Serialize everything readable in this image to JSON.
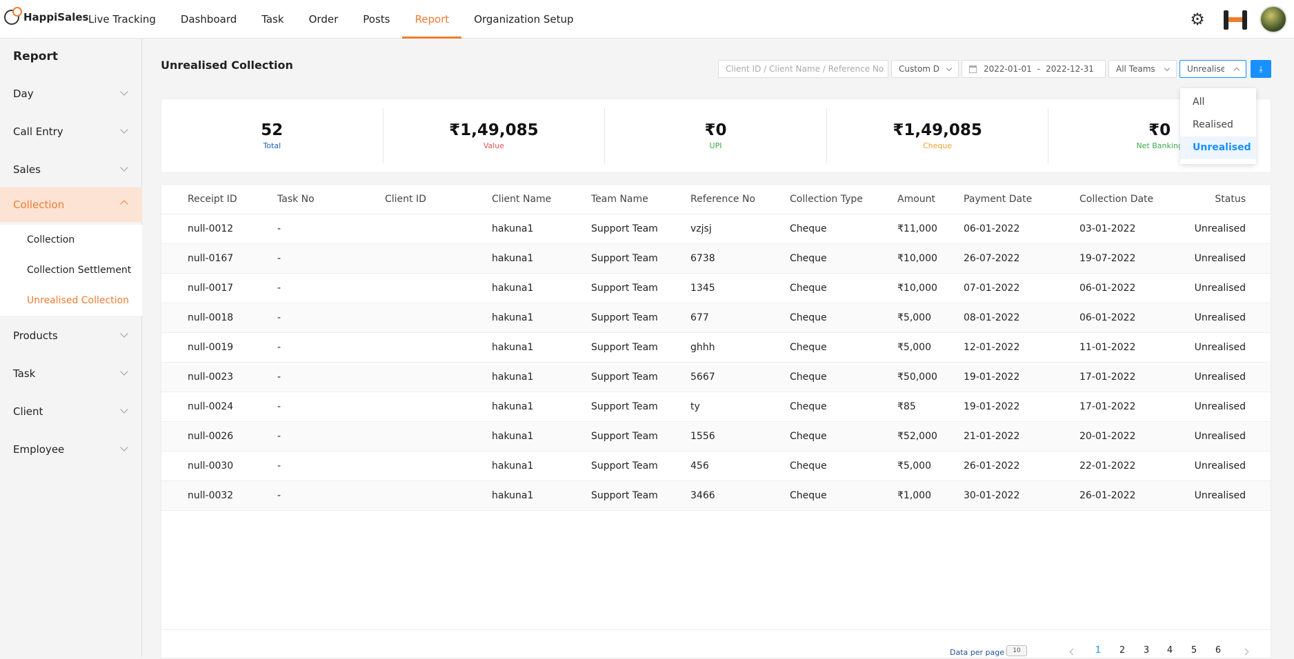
{
  "app": {
    "logo_text": "HappiSales",
    "nav": [
      "Live Tracking",
      "Dashboard",
      "Task",
      "Order",
      "Posts",
      "Report",
      "Organization Setup"
    ],
    "active_nav": "Report",
    "accent_color": "#f07c30",
    "primary_color": "#1890ff"
  },
  "sidebar": {
    "title": "Report",
    "items": [
      {
        "label": "Day"
      },
      {
        "label": "Call Entry"
      },
      {
        "label": "Sales"
      },
      {
        "label": "Collection",
        "open": true
      },
      {
        "label": "Products"
      },
      {
        "label": "Task"
      },
      {
        "label": "Client"
      },
      {
        "label": "Employee"
      }
    ],
    "collection_subitems": [
      "Collection",
      "Collection Settlement",
      "Unrealised Collection"
    ],
    "active_subitem": "Unrealised Collection"
  },
  "page": {
    "title": "Unrealised Collection"
  },
  "filters": {
    "search_placeholder": "Client ID / Client Name / Reference No",
    "date_mode": "Custom D",
    "date_from": "2022-01-01",
    "date_sep": "-",
    "date_to": "2022-12-31",
    "team": "All Teams",
    "status": "Unrealised"
  },
  "status_dropdown": {
    "options": [
      "All",
      "Realised",
      "Unrealised"
    ],
    "selected": "Unrealised"
  },
  "stats": [
    {
      "value": "52",
      "label": "Total",
      "color": "#1f5fb5"
    },
    {
      "value": "₹1,49,085",
      "label": "Value",
      "color": "#e05555"
    },
    {
      "value": "₹0",
      "label": "UPI",
      "color": "#3aa84a"
    },
    {
      "value": "₹1,49,085",
      "label": "Cheque",
      "color": "#f0a030"
    },
    {
      "value": "₹0",
      "label": "Net Banking",
      "color": "#3aa84a"
    }
  ],
  "table": {
    "columns": [
      "Receipt ID",
      "Task No",
      "Client ID",
      "Client Name",
      "Team Name",
      "Reference No",
      "Collection Type",
      "Amount",
      "Payment Date",
      "Collection Date",
      "Status"
    ],
    "rows": [
      [
        "null-0012",
        "-",
        "",
        "hakuna1",
        "Support Team",
        "vzjsj",
        "Cheque",
        "₹11,000",
        "06-01-2022",
        "03-01-2022",
        "Unrealised"
      ],
      [
        "null-0167",
        "-",
        "",
        "hakuna1",
        "Support Team",
        "6738",
        "Cheque",
        "₹10,000",
        "26-07-2022",
        "19-07-2022",
        "Unrealised"
      ],
      [
        "null-0017",
        "-",
        "",
        "hakuna1",
        "Support Team",
        "1345",
        "Cheque",
        "₹10,000",
        "07-01-2022",
        "06-01-2022",
        "Unrealised"
      ],
      [
        "null-0018",
        "-",
        "",
        "hakuna1",
        "Support Team",
        "677",
        "Cheque",
        "₹5,000",
        "08-01-2022",
        "06-01-2022",
        "Unrealised"
      ],
      [
        "null-0019",
        "-",
        "",
        "hakuna1",
        "Support Team",
        "ghhh",
        "Cheque",
        "₹5,000",
        "12-01-2022",
        "11-01-2022",
        "Unrealised"
      ],
      [
        "null-0023",
        "-",
        "",
        "hakuna1",
        "Support Team",
        "5667",
        "Cheque",
        "₹50,000",
        "19-01-2022",
        "17-01-2022",
        "Unrealised"
      ],
      [
        "null-0024",
        "-",
        "",
        "hakuna1",
        "Support Team",
        "ty",
        "Cheque",
        "₹85",
        "19-01-2022",
        "17-01-2022",
        "Unrealised"
      ],
      [
        "null-0026",
        "-",
        "",
        "hakuna1",
        "Support Team",
        "1556",
        "Cheque",
        "₹52,000",
        "21-01-2022",
        "20-01-2022",
        "Unrealised"
      ],
      [
        "null-0030",
        "-",
        "",
        "hakuna1",
        "Support Team",
        "456",
        "Cheque",
        "₹5,000",
        "26-01-2022",
        "22-01-2022",
        "Unrealised"
      ],
      [
        "null-0032",
        "-",
        "",
        "hakuna1",
        "Support Team",
        "3466",
        "Cheque",
        "₹1,000",
        "30-01-2022",
        "26-01-2022",
        "Unrealised"
      ]
    ]
  },
  "pagination": {
    "per_page_label": "Data per page",
    "per_page": "10",
    "pages": [
      "1",
      "2",
      "3",
      "4",
      "5",
      "6"
    ],
    "current": "1"
  }
}
